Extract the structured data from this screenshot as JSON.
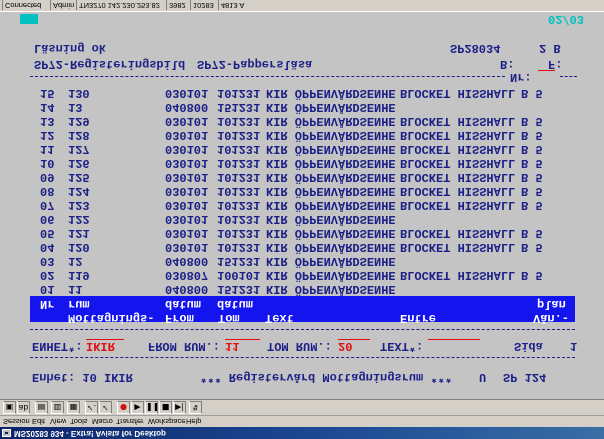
{
  "window": {
    "title": "MS20283 934 - Extra! Avista for Desktop"
  },
  "menu": {
    "items": [
      "Session",
      "Edit",
      "View",
      "Tools",
      "Macro",
      "Transfer",
      "Workspace",
      "Help"
    ]
  },
  "toolbar": {
    "icons": [
      "session-icon",
      "font-icon",
      "copy-icon",
      "paste-icon",
      "print-icon",
      "check-icon",
      "check-all-icon",
      "record-icon",
      "play-icon",
      "pause-icon",
      "stop-icon",
      "step-icon",
      "connect-icon"
    ]
  },
  "screen": {
    "header": {
      "unit": "Enhet: 10 IKIR",
      "title": "*** Registervård Mottagningsrum ***",
      "mode": "U",
      "program": "SP 124"
    },
    "filter": {
      "unit_label": "ENHET*:",
      "unit_value": "IKIR",
      "from_label": "FROM RUM.:",
      "from_value": "11",
      "to_label": "TOM RUM.:",
      "to_value": "20",
      "text_label": "TEXT*:",
      "text_value": "",
      "page_label": "Sida",
      "page_value": "1"
    },
    "columns": {
      "line1": {
        "mottagning": "Mottagnings-",
        "from": "From",
        "tom": "Tom",
        "text": "Text",
        "entre": "Entre",
        "plan": "Vån.-"
      },
      "line2": {
        "nr": "Nr",
        "rum": "rum",
        "from": "datum",
        "tom": "datum",
        "plan": "plan"
      }
    },
    "rows": [
      {
        "nr": "01",
        "rum": "11",
        "from": "040800",
        "tom": "151231",
        "text": "KIR ÖPPENVÅRDSENHE",
        "entre": "",
        "plan": ""
      },
      {
        "nr": "02",
        "rum": "119",
        "from": "030807",
        "tom": "100101",
        "text": "KIR ÖPPENVÅRDSENHE",
        "entre": "BLOCKET HISSHALL",
        "plan": "B 5"
      },
      {
        "nr": "03",
        "rum": "12",
        "from": "040800",
        "tom": "151231",
        "text": "KIR ÖPPENVÅRDSENHE",
        "entre": "",
        "plan": ""
      },
      {
        "nr": "04",
        "rum": "120",
        "from": "030101",
        "tom": "101231",
        "text": "KIR ÖPPENVÅRDSENHE",
        "entre": "BLOCKET HISSHALL",
        "plan": "B 5"
      },
      {
        "nr": "05",
        "rum": "121",
        "from": "030101",
        "tom": "101231",
        "text": "KIR ÖPPENVÅRDSENHE",
        "entre": "BLOCKET HISSHALL",
        "plan": "B 5"
      },
      {
        "nr": "06",
        "rum": "122",
        "from": "030101",
        "tom": "101231",
        "text": "KIR ÖPPENVÅRDSENHE",
        "entre": "",
        "plan": ""
      },
      {
        "nr": "07",
        "rum": "123",
        "from": "030101",
        "tom": "101231",
        "text": "KIR ÖPPENVÅRDSENHE",
        "entre": "BLOCKET HISSHALL",
        "plan": "B 5"
      },
      {
        "nr": "08",
        "rum": "124",
        "from": "030101",
        "tom": "101231",
        "text": "KIR ÖPPENVÅRDSENHE",
        "entre": "BLOCKET HISSHALL",
        "plan": "B 5"
      },
      {
        "nr": "09",
        "rum": "125",
        "from": "030101",
        "tom": "101231",
        "text": "KIR ÖPPENVÅRDSENHE",
        "entre": "BLOCKET HISSHALL",
        "plan": "B 5"
      },
      {
        "nr": "10",
        "rum": "126",
        "from": "030101",
        "tom": "101231",
        "text": "KIR ÖPPENVÅRDSENHE",
        "entre": "BLOCKET HISSHALL",
        "plan": "B 5"
      },
      {
        "nr": "11",
        "rum": "127",
        "from": "030101",
        "tom": "101231",
        "text": "KIR ÖPPENVÅRDSENHE",
        "entre": "BLOCKET HISSHALL",
        "plan": "B 5"
      },
      {
        "nr": "12",
        "rum": "128",
        "from": "030101",
        "tom": "101231",
        "text": "KIR ÖPPENVÅRDSENHE",
        "entre": "BLOCKET HISSHALL",
        "plan": "B 5"
      },
      {
        "nr": "13",
        "rum": "129",
        "from": "030101",
        "tom": "101231",
        "text": "KIR ÖPPENVÅRDSENHE",
        "entre": "BLOCKET HISSHALL",
        "plan": "B 5"
      },
      {
        "nr": "14",
        "rum": "13",
        "from": "040800",
        "tom": "151231",
        "text": "KIR ÖPPENVÅRDSENHE",
        "entre": "",
        "plan": ""
      },
      {
        "nr": "15",
        "rum": "130",
        "from": "030101",
        "tom": "101231",
        "text": "KIR ÖPPENVÅRDSENHE",
        "entre": "BLOCKET HISSHALL",
        "plan": "B 5"
      }
    ],
    "nr_label": "Nr:",
    "nr_value": "",
    "functions": {
      "left": "SP72-Registeringsbild",
      "right": "SP72-Pappersläsa",
      "b_label": "B:",
      "f_label": "F:"
    },
    "message": {
      "text": "Läsning ok",
      "code": "SP28034",
      "page": "2 B"
    },
    "oia": {
      "position": "02/03"
    }
  },
  "statusbar": {
    "items": [
      "Connected",
      "Admin",
      "TN3270 142.230.253.82",
      "3982",
      "10283",
      "4813 A"
    ]
  },
  "colors": {
    "terminal_bg": "#c4c4c4",
    "terminal_text": "#1b1f86",
    "highlight": "#1414ee",
    "field": "#e01010",
    "oia": "#00c0c0",
    "titlebar": "#0a246a"
  }
}
